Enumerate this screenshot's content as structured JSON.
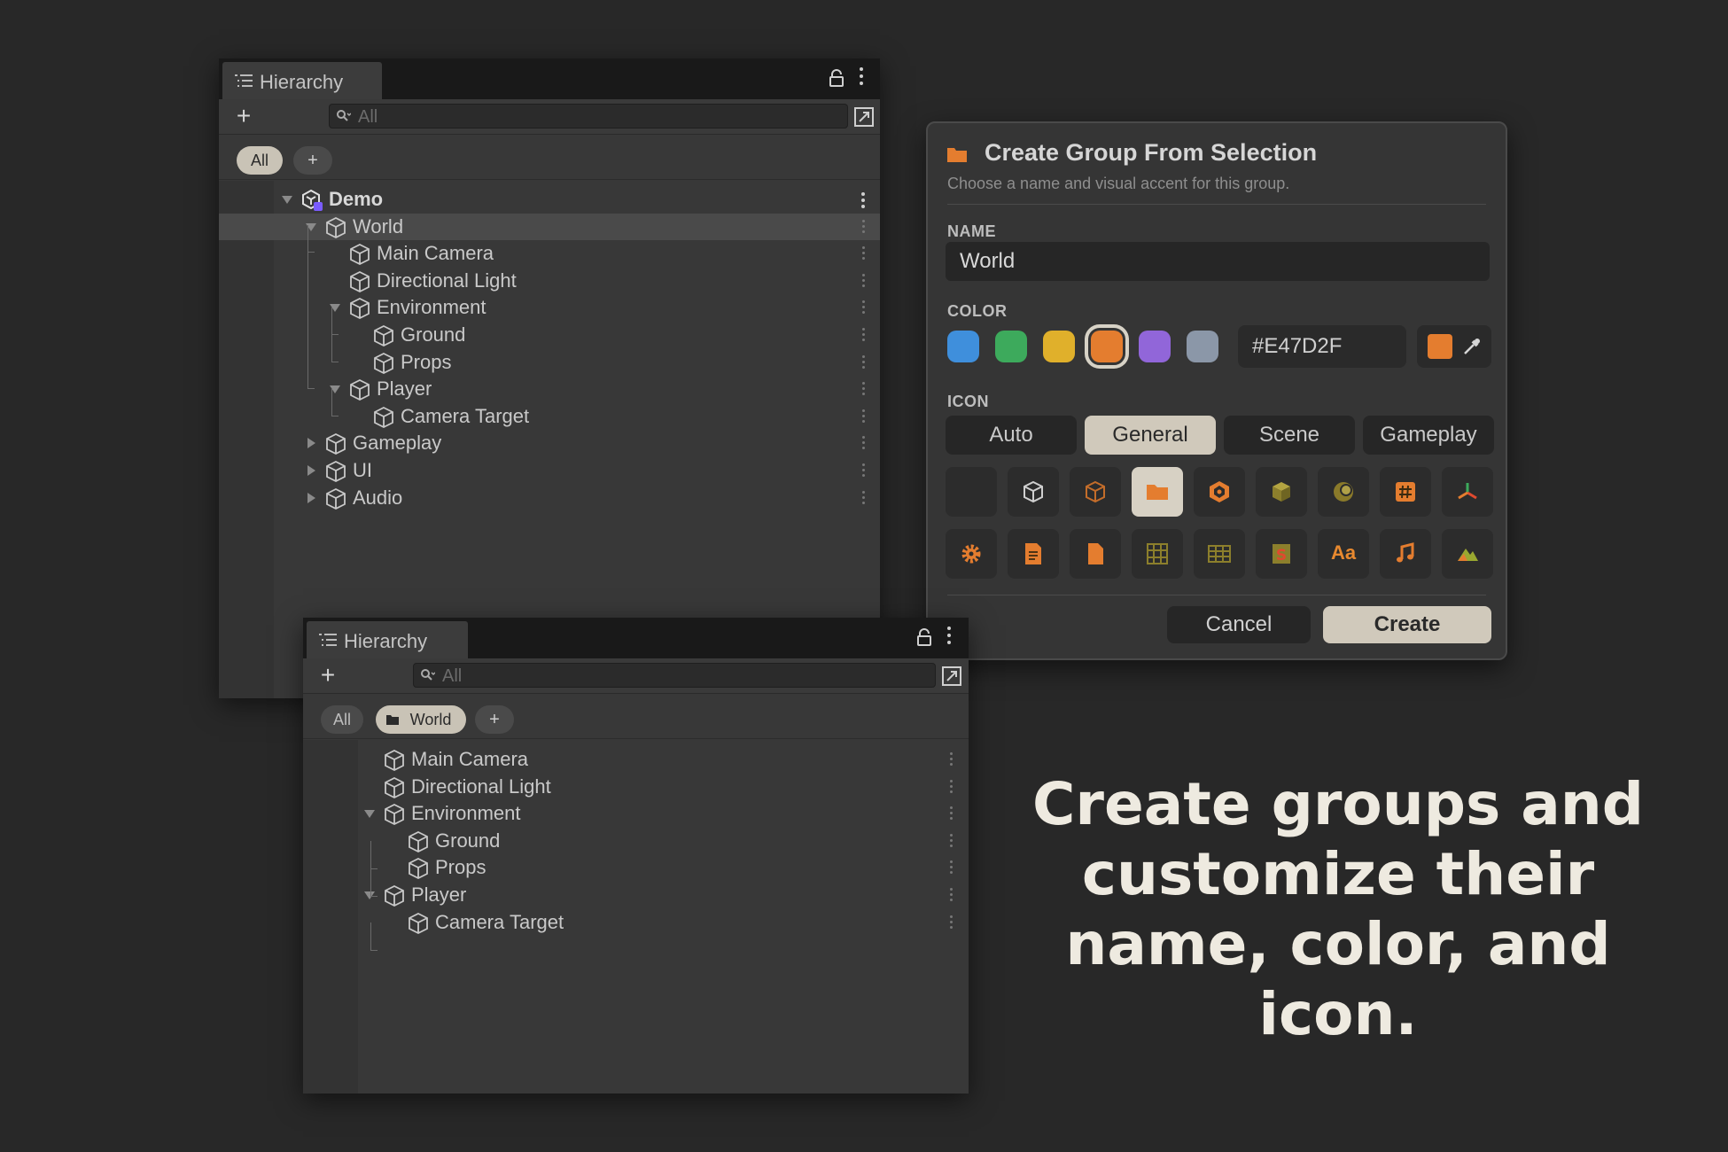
{
  "colors": {
    "background": "#282828",
    "accent_orange": "#E47D2F",
    "chip_active": "#c9c3b6",
    "selected_row": "#4a4a4a"
  },
  "hierarchy_top": {
    "tab_title": "Hierarchy",
    "search_placeholder": "All",
    "chips": [
      "All",
      "+"
    ],
    "rows": [
      {
        "label": "Demo",
        "depth": 0,
        "expanded": true,
        "icon": "unity-scene-icon"
      },
      {
        "label": "World",
        "depth": 1,
        "expanded": true,
        "selected": true,
        "icon": "cube-icon"
      },
      {
        "label": "Main Camera",
        "depth": 2,
        "icon": "cube-icon"
      },
      {
        "label": "Directional Light",
        "depth": 2,
        "icon": "cube-icon"
      },
      {
        "label": "Environment",
        "depth": 2,
        "expanded": true,
        "icon": "cube-icon"
      },
      {
        "label": "Ground",
        "depth": 3,
        "icon": "cube-icon"
      },
      {
        "label": "Props",
        "depth": 3,
        "icon": "cube-icon"
      },
      {
        "label": "Player",
        "depth": 2,
        "expanded": true,
        "icon": "cube-icon"
      },
      {
        "label": "Camera Target",
        "depth": 3,
        "icon": "cube-icon"
      },
      {
        "label": "Gameplay",
        "depth": 1,
        "collapsed": true,
        "icon": "cube-icon"
      },
      {
        "label": "UI",
        "depth": 1,
        "collapsed": true,
        "icon": "cube-icon"
      },
      {
        "label": "Audio",
        "depth": 1,
        "collapsed": true,
        "icon": "cube-icon"
      }
    ]
  },
  "hierarchy_bottom": {
    "tab_title": "Hierarchy",
    "search_placeholder": "All",
    "chips": [
      "All",
      "World",
      "+"
    ],
    "rows": [
      {
        "label": "Main Camera",
        "depth": 0
      },
      {
        "label": "Directional Light",
        "depth": 0
      },
      {
        "label": "Environment",
        "depth": 0,
        "expanded": true
      },
      {
        "label": "Ground",
        "depth": 1
      },
      {
        "label": "Props",
        "depth": 1
      },
      {
        "label": "Player",
        "depth": 0,
        "expanded": true
      },
      {
        "label": "Camera Target",
        "depth": 1
      }
    ]
  },
  "dialog": {
    "title": "Create Group From Selection",
    "subtitle": "Choose a name and visual accent for this group.",
    "name_label": "NAME",
    "name_value": "World",
    "color_label": "COLOR",
    "swatches": [
      "#3f8fdc",
      "#3daa5c",
      "#e0b02b",
      "#e47d2f",
      "#9166d9",
      "#8b97a8"
    ],
    "selected_swatch": 3,
    "hex_value": "#E47D2F",
    "icon_label": "ICON",
    "icon_tabs": [
      "Auto",
      "General",
      "Scene",
      "Gameplay"
    ],
    "active_icon_tab": "General",
    "icon_grid_row1": [
      "none",
      "cube-outline-icon",
      "cube-orange-icon",
      "folder-icon",
      "unity-logo-icon",
      "package-icon",
      "sphere-icon",
      "hash-icon",
      "transform-axes-icon"
    ],
    "icon_grid_row2": [
      "gear-icon",
      "document-lines-icon",
      "document-icon",
      "grid-icon",
      "table-icon",
      "script-icon",
      "font-icon",
      "music-note-icon",
      "terrain-icon"
    ],
    "font_icon_text": "Aa",
    "cancel_label": "Cancel",
    "create_label": "Create"
  },
  "caption": "Create groups and customize their name, color, and icon."
}
